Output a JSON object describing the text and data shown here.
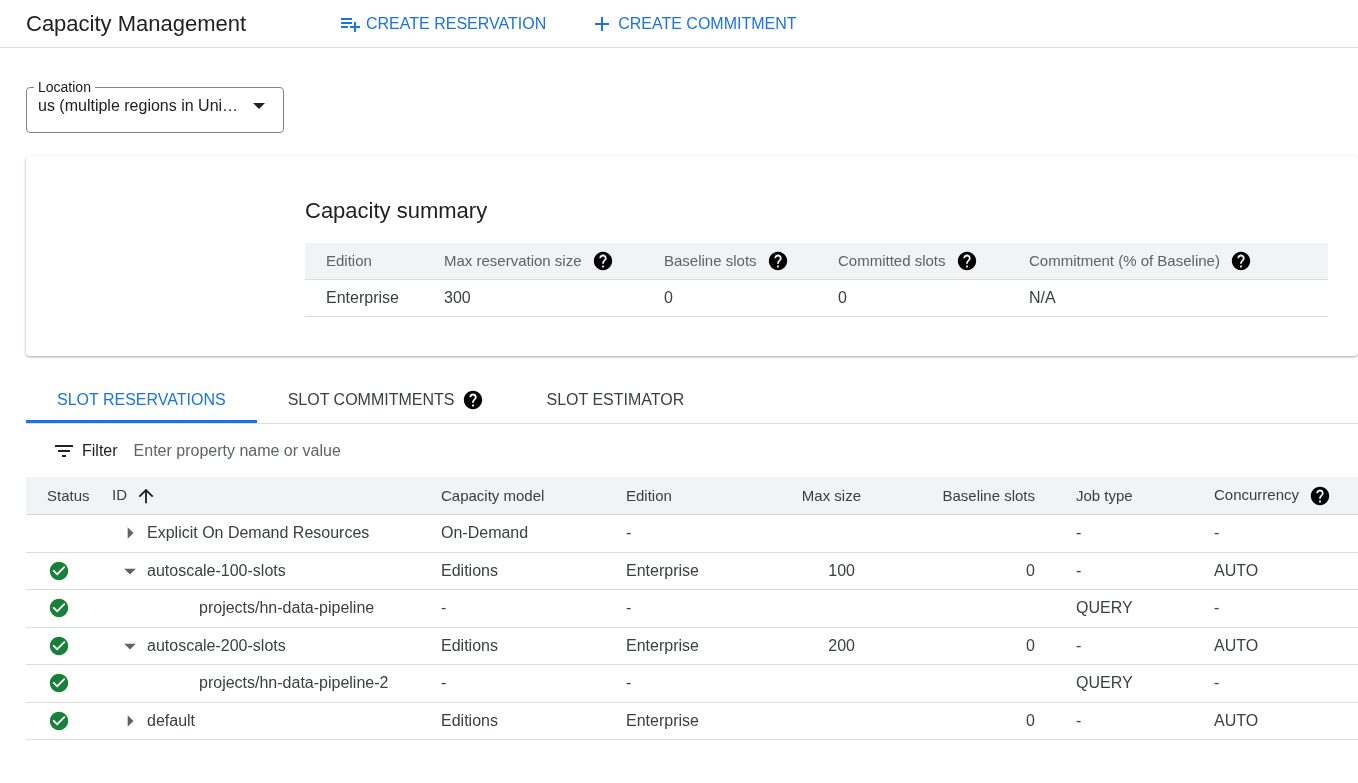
{
  "header": {
    "title": "Capacity Management",
    "actions": [
      {
        "kind": "reservation",
        "label": "CREATE RESERVATION"
      },
      {
        "kind": "commitment",
        "label": "CREATE COMMITMENT"
      }
    ]
  },
  "location": {
    "label": "Location",
    "value": "us (multiple regions in Uni…"
  },
  "summary": {
    "title": "Capacity summary",
    "columns": [
      {
        "label": "Edition",
        "help": false
      },
      {
        "label": "Max reservation size",
        "help": true
      },
      {
        "label": "Baseline slots",
        "help": true
      },
      {
        "label": "Committed slots",
        "help": true
      },
      {
        "label": "Commitment (% of Baseline)",
        "help": true
      }
    ],
    "row": [
      "Enterprise",
      "300",
      "0",
      "0",
      "N/A"
    ]
  },
  "tabs": [
    {
      "label": "SLOT RESERVATIONS",
      "selected": true,
      "help": false
    },
    {
      "label": "SLOT COMMITMENTS",
      "selected": false,
      "help": true
    },
    {
      "label": "SLOT ESTIMATOR",
      "selected": false,
      "help": false
    }
  ],
  "filter": {
    "label": "Filter",
    "placeholder": "Enter property name or value"
  },
  "table": {
    "columns": [
      {
        "label": "Status",
        "help": false,
        "sorted": false
      },
      {
        "label": "ID",
        "help": false,
        "sorted": true
      },
      {
        "label": "Capacity model",
        "help": false,
        "sorted": false
      },
      {
        "label": "Edition",
        "help": false,
        "sorted": false
      },
      {
        "label": "Max size",
        "help": false,
        "sorted": false
      },
      {
        "label": "Baseline slots",
        "help": false,
        "sorted": false
      },
      {
        "label": "Job type",
        "help": false,
        "sorted": false
      },
      {
        "label": "Concurrency",
        "help": true,
        "sorted": false
      }
    ],
    "rows": [
      {
        "status_ok": false,
        "id": "Explicit On Demand Resources",
        "expanded": false,
        "capacity_model": "On-Demand",
        "edition": "-",
        "job_type": "-",
        "concurrency": "-"
      },
      {
        "status_ok": true,
        "id": "autoscale-100-slots",
        "expanded": true,
        "capacity_model": "Editions",
        "edition": "Enterprise",
        "max_size": "100",
        "baseline_slots": "0",
        "job_type": "-",
        "concurrency": "AUTO",
        "children": [
          {
            "status_ok": true,
            "id": "projects/hn-data-pipeline",
            "capacity_model": "-",
            "edition": "-",
            "job_type": "QUERY",
            "concurrency": "-"
          }
        ]
      },
      {
        "status_ok": true,
        "id": "autoscale-200-slots",
        "expanded": true,
        "capacity_model": "Editions",
        "edition": "Enterprise",
        "max_size": "200",
        "baseline_slots": "0",
        "job_type": "-",
        "concurrency": "AUTO",
        "children": [
          {
            "status_ok": true,
            "id": "projects/hn-data-pipeline-2",
            "capacity_model": "-",
            "edition": "-",
            "job_type": "QUERY",
            "concurrency": "-"
          }
        ]
      },
      {
        "status_ok": true,
        "id": "default",
        "expanded": false,
        "capacity_model": "Editions",
        "edition": "Enterprise",
        "baseline_slots": "0",
        "job_type": "-",
        "concurrency": "AUTO"
      }
    ]
  }
}
